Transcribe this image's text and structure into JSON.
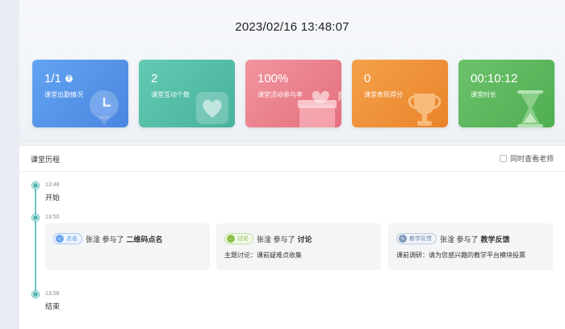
{
  "datetime": "2023/02/16 13:48:07",
  "cards": [
    {
      "value": "1/1",
      "label": "课堂出勤情况",
      "color": "#4c8fe6",
      "icon": "clock-pin-icon"
    },
    {
      "value": "2",
      "label": "课堂互动个数",
      "color": "#4fb9a6",
      "icon": "heart-icon"
    },
    {
      "value": "100%",
      "label": "课堂活动参与率",
      "color": "#ea7c8a",
      "icon": "gift-box-icon"
    },
    {
      "value": "0",
      "label": "课堂表现得分",
      "color": "#ec8a34",
      "icon": "trophy-icon"
    },
    {
      "value": "00:10:12",
      "label": "课堂时长",
      "color": "#5cb85c",
      "icon": "hourglass-icon"
    }
  ],
  "history": {
    "title": "课堂历程",
    "teacher_option": "同时查看老师",
    "events": [
      {
        "time": "13:48",
        "text": "开始"
      },
      {
        "time": "13:50",
        "text": ""
      },
      {
        "time": "13:58",
        "text": "结束"
      }
    ],
    "activities": [
      {
        "tag": "点名",
        "actor": "张淦",
        "verb": "参与了",
        "name": "二维码点名",
        "detail": ""
      },
      {
        "tag": "讨论",
        "actor": "张淦",
        "verb": "参与了",
        "name": "讨论",
        "detail": "主题讨论：课前疑难点收集"
      },
      {
        "tag": "教学反馈",
        "actor": "张淦",
        "verb": "参与了",
        "name": "教学反馈",
        "detail": "课前调研：请为您感兴趣的教学平台模块投票"
      }
    ]
  }
}
